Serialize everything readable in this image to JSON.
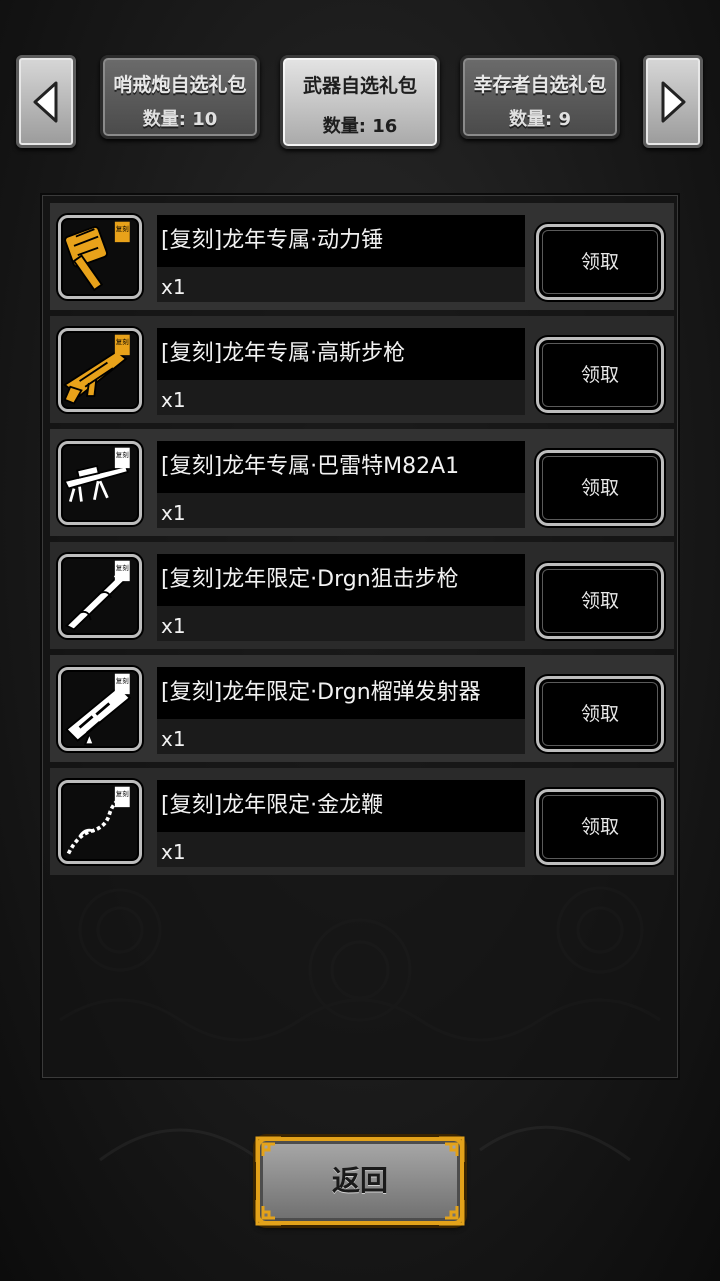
{
  "tabs": [
    {
      "name": "哨戒炮自选礼包",
      "count": "数量: 10",
      "active": false
    },
    {
      "name": "武器自选礼包",
      "count": "数量: 16",
      "active": true
    },
    {
      "name": "幸存者自选礼包",
      "count": "数量: 9",
      "active": false
    }
  ],
  "items": [
    {
      "name": "[复刻]龙年专属·动力锤",
      "qty": "x1",
      "claim": "领取",
      "badge": "复刻",
      "icon": "power-hammer-icon",
      "color": "#e8a21a"
    },
    {
      "name": "[复刻]龙年专属·高斯步枪",
      "qty": "x1",
      "claim": "领取",
      "badge": "复刻",
      "icon": "gauss-rifle-icon",
      "color": "#e8a21a"
    },
    {
      "name": "[复刻]龙年专属·巴雷特M82A1",
      "qty": "x1",
      "claim": "领取",
      "badge": "复刻",
      "icon": "sniper-rifle-icon",
      "color": "#ffffff"
    },
    {
      "name": "[复刻]龙年限定·Drgn狙击步枪",
      "qty": "x1",
      "claim": "领取",
      "badge": "复刻",
      "icon": "dragon-sniper-icon",
      "color": "#ffffff"
    },
    {
      "name": "[复刻]龙年限定·Drgn榴弹发射器",
      "qty": "x1",
      "claim": "领取",
      "badge": "复刻",
      "icon": "dragon-launcher-icon",
      "color": "#ffffff"
    },
    {
      "name": "[复刻]龙年限定·金龙鞭",
      "qty": "x1",
      "claim": "领取",
      "badge": "复刻",
      "icon": "dragon-whip-icon",
      "color": "#ffffff"
    }
  ],
  "footer": {
    "return_label": "返回"
  },
  "colors": {
    "accent_gold": "#e3a21a",
    "panel_bg": "#323232",
    "tab_active": "#d0d0d0"
  }
}
